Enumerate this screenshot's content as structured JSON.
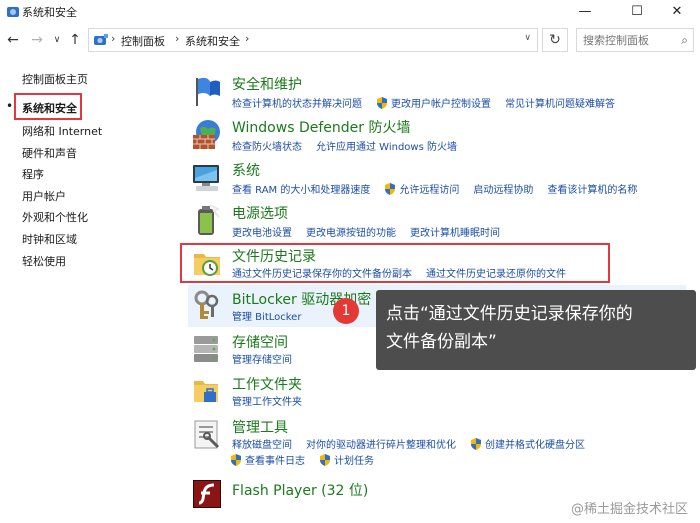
{
  "window": {
    "title": "系统和安全",
    "minimize_glyph": "—",
    "maximize_glyph": "☐",
    "close_glyph": "✕"
  },
  "nav": {
    "back_glyph": "←",
    "forward_glyph": "→",
    "recent_glyph": "∨",
    "up_glyph": "↑",
    "breadcrumb": [
      "控制面板",
      "系统和安全"
    ],
    "separator": "›",
    "dropdown_glyph": "∨",
    "refresh_glyph": "↻",
    "search_placeholder": "搜索控制面板",
    "search_glyph": "⌕"
  },
  "sidebar": {
    "items": [
      {
        "label": "控制面板主页"
      },
      {
        "label": "系统和安全",
        "selected": true
      },
      {
        "label": "网络和 Internet"
      },
      {
        "label": "硬件和声音"
      },
      {
        "label": "程序"
      },
      {
        "label": "用户帐户"
      },
      {
        "label": "外观和个性化"
      },
      {
        "label": "时钟和区域"
      },
      {
        "label": "轻松使用"
      }
    ],
    "bullet": "•"
  },
  "categories": [
    {
      "title": "安全和维护",
      "icon": "security-flag-icon",
      "links": [
        {
          "text": "检查计算机的状态并解决问题"
        },
        {
          "text": "更改用户帐户控制设置",
          "shield": true
        },
        {
          "text": "常见计算机问题疑难解答"
        }
      ]
    },
    {
      "title": "Windows Defender 防火墙",
      "icon": "firewall-icon",
      "links": [
        {
          "text": "检查防火墙状态"
        },
        {
          "text": "允许应用通过 Windows 防火墙"
        }
      ]
    },
    {
      "title": "系统",
      "icon": "system-computer-icon",
      "links": [
        {
          "text": "查看 RAM 的大小和处理器速度"
        },
        {
          "text": "允许远程访问",
          "shield": true
        },
        {
          "text": "启动远程协助"
        },
        {
          "text": "查看该计算机的名称"
        }
      ]
    },
    {
      "title": "电源选项",
      "icon": "power-battery-icon",
      "links": [
        {
          "text": "更改电池设置"
        },
        {
          "text": "更改电源按钮的功能"
        },
        {
          "text": "更改计算机睡眠时间"
        }
      ]
    },
    {
      "title": "文件历史记录",
      "icon": "file-history-icon",
      "links": [
        {
          "text": "通过文件历史记录保存你的文件备份副本"
        },
        {
          "text": "通过文件历史记录还原你的文件"
        }
      ]
    },
    {
      "title": "BitLocker 驱动器加密",
      "icon": "bitlocker-keys-icon",
      "links": [
        {
          "text": "管理 BitLocker"
        }
      ]
    },
    {
      "title": "存储空间",
      "icon": "storage-spaces-icon",
      "links": [
        {
          "text": "管理存储空间"
        }
      ]
    },
    {
      "title": "工作文件夹",
      "icon": "work-folders-icon",
      "links": [
        {
          "text": "管理工作文件夹"
        }
      ]
    },
    {
      "title": "管理工具",
      "icon": "admin-tools-icon",
      "links": [
        {
          "text": "释放磁盘空间"
        },
        {
          "text": "对你的驱动器进行碎片整理和优化"
        },
        {
          "text": "创建并格式化硬盘分区",
          "shield": true
        }
      ],
      "links2": [
        {
          "text": "查看事件日志",
          "shield": true
        },
        {
          "text": "计划任务",
          "shield": true
        }
      ]
    },
    {
      "title": "Flash Player (32 位)",
      "icon": "flash-player-icon",
      "links": []
    }
  ],
  "callout": {
    "step": "1",
    "line1": "点击“通过文件历史记录保存你的",
    "line2": "文件备份副本”"
  },
  "watermark": "@稀土掘金技术社区",
  "colors": {
    "title_green": "#1b7a1b",
    "link_blue": "#1c4ea8",
    "highlight_red": "#e0393e",
    "callout_bg": "#4d4d4d"
  }
}
